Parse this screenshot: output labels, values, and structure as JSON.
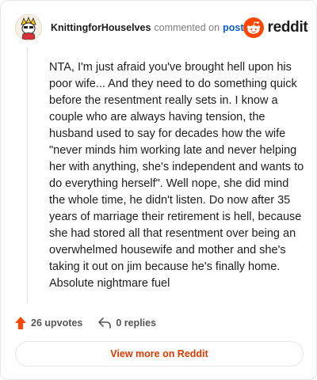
{
  "comment": {
    "username": "KnittingforHouselves",
    "action_text": "commented on",
    "post_link_label": "post",
    "body": "NTA, I'm just afraid you've brought hell upon his poor wife... And they need to do something quick before the resentment really sets in. I know a couple who are always having tension, the husband used to say for decades how the wife \"never minds him working late and never helping her with anything, she's independent and wants to do everything herself\". Well nope, she did mind the whole time, he didn't listen. Do now after 35 years of marriage their retirement is hell, because she had stored all that resentment over being an overwhelmed housewife and mother and she's taking it out on jim because he's finally home. Absolute nightmare fuel"
  },
  "brand": {
    "wordmark": "reddit",
    "color": "#ff4500"
  },
  "stats": {
    "upvotes_label": "26 upvotes",
    "replies_label": "0 replies"
  },
  "footer": {
    "view_more_label": "View more on Reddit"
  },
  "colors": {
    "accent": "#d93a00",
    "link": "#0b5fc9",
    "upvote": "#ff4500"
  },
  "icons": {
    "avatar": "cartoon-avatar-icon",
    "brand": "reddit-snoo-icon",
    "upvote": "upvote-arrow-icon",
    "reply": "reply-arrow-icon"
  }
}
